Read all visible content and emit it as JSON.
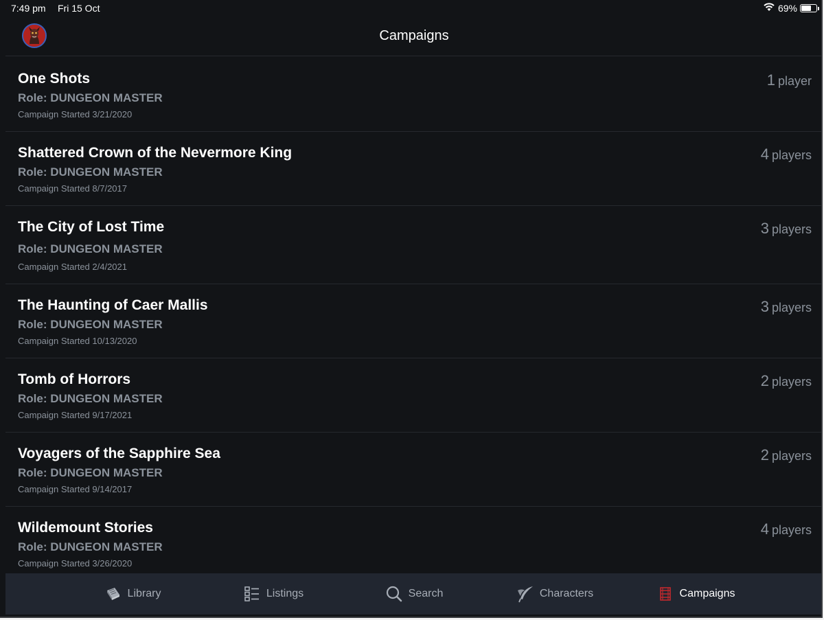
{
  "status": {
    "time": "7:49 pm",
    "date": "Fri 15 Oct",
    "battery_percent": "69%",
    "battery_level": 0.69
  },
  "nav": {
    "title": "Campaigns",
    "avatar_icon": "dragon-avatar-icon"
  },
  "campaigns": [
    {
      "title": "One Shots",
      "role": "Role: DUNGEON MASTER",
      "started": "Campaign Started 3/21/2020",
      "player_count": "1",
      "player_label": "player"
    },
    {
      "title": "Shattered Crown of the Nevermore King",
      "role": "Role: DUNGEON MASTER",
      "started": "Campaign Started 8/7/2017",
      "player_count": "4",
      "player_label": "players"
    },
    {
      "title": "The City of Lost Time",
      "role": "Role: DUNGEON MASTER",
      "started": "Campaign Started 2/4/2021",
      "player_count": "3",
      "player_label": "players"
    },
    {
      "title": "The Haunting of Caer Mallis",
      "role": "Role: DUNGEON MASTER",
      "started": "Campaign Started 10/13/2020",
      "player_count": "3",
      "player_label": "players"
    },
    {
      "title": "Tomb of Horrors",
      "role": "Role: DUNGEON MASTER",
      "started": "Campaign Started 9/17/2021",
      "player_count": "2",
      "player_label": "players"
    },
    {
      "title": "Voyagers of the Sapphire Sea",
      "role": "Role: DUNGEON MASTER",
      "started": "Campaign Started 9/14/2017",
      "player_count": "2",
      "player_label": "players"
    },
    {
      "title": "Wildemount Stories",
      "role": "Role: DUNGEON MASTER",
      "started": "Campaign Started 3/26/2020",
      "player_count": "4",
      "player_label": "players"
    }
  ],
  "tabs": [
    {
      "label": "Library",
      "icon": "library-book-icon"
    },
    {
      "label": "Listings",
      "icon": "listings-icon"
    },
    {
      "label": "Search",
      "icon": "search-icon"
    },
    {
      "label": "Characters",
      "icon": "characters-quill-icon"
    },
    {
      "label": "Campaigns",
      "icon": "campaigns-icon",
      "active": true
    }
  ],
  "colors": {
    "background": "#121417",
    "tab_bar": "#212630",
    "secondary_text": "#8b929b",
    "campaigns_accent": "#c0282d"
  }
}
